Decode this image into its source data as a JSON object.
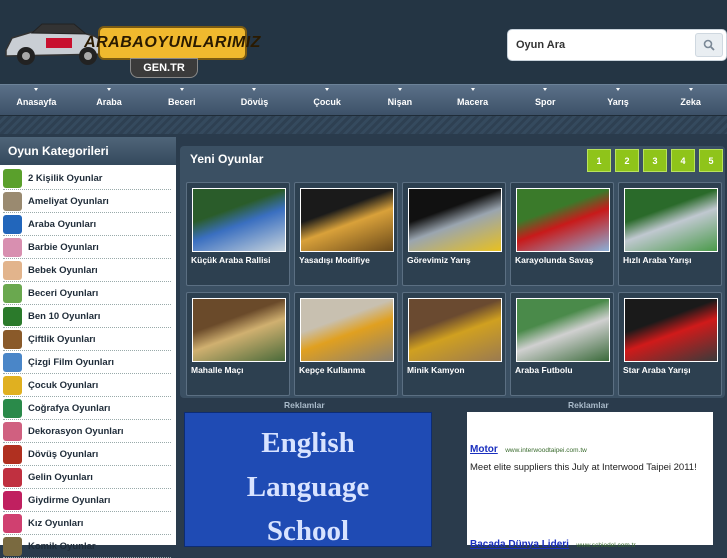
{
  "header": {
    "logo_text": "ARABAOYUNLARIMIZ",
    "logo_sub": "GEN.TR",
    "search_placeholder": "Oyun Ara"
  },
  "nav": {
    "items": [
      "Anasayfa",
      "Araba",
      "Beceri",
      "Dövüş",
      "Çocuk",
      "Nişan",
      "Macera",
      "Spor",
      "Yarış",
      "Zeka"
    ]
  },
  "sidebar": {
    "title": "Oyun Kategorileri",
    "items": [
      {
        "label": "2 Kişilik Oyunlar",
        "icon": "puzzle-icon",
        "color": "#5aa02c"
      },
      {
        "label": "Ameliyat Oyunları",
        "icon": "doctor-icon",
        "color": "#9a8a70"
      },
      {
        "label": "Araba Oyunları",
        "icon": "car-icon",
        "color": "#2266bb"
      },
      {
        "label": "Barbie Oyunları",
        "icon": "barbie-icon",
        "color": "#d88fb0"
      },
      {
        "label": "Bebek Oyunları",
        "icon": "baby-icon",
        "color": "#e2b48c"
      },
      {
        "label": "Beceri Oyunları",
        "icon": "skill-icon",
        "color": "#6aa84f"
      },
      {
        "label": "Ben 10 Oyunları",
        "icon": "ben10-icon",
        "color": "#2b7a2b"
      },
      {
        "label": "Çiftlik Oyunları",
        "icon": "farm-icon",
        "color": "#8a5a2a"
      },
      {
        "label": "Çizgi Film Oyunları",
        "icon": "cartoon-icon",
        "color": "#4a86c8"
      },
      {
        "label": "Çocuk Oyunları",
        "icon": "kids-icon",
        "color": "#e0b020"
      },
      {
        "label": "Coğrafya Oyunları",
        "icon": "globe-icon",
        "color": "#2a8a4a"
      },
      {
        "label": "Dekorasyon Oyunları",
        "icon": "decor-icon",
        "color": "#d06080"
      },
      {
        "label": "Dövüş Oyunları",
        "icon": "fight-icon",
        "color": "#b03020"
      },
      {
        "label": "Gelin Oyunları",
        "icon": "bride-icon",
        "color": "#c03040"
      },
      {
        "label": "Giydirme Oyunları",
        "icon": "dressup-icon",
        "color": "#c02060"
      },
      {
        "label": "Kız Oyunları",
        "icon": "girl-icon",
        "color": "#d04070"
      },
      {
        "label": "Komik Oyunlar",
        "icon": "funny-icon",
        "color": "#7a6a40"
      }
    ]
  },
  "main": {
    "title": "Yeni Oyunlar",
    "pages": [
      "1",
      "2",
      "3",
      "4",
      "5"
    ],
    "games": [
      {
        "title": "Küçük Araba Rallisi",
        "thumb_colors": [
          "#2a5c2a",
          "#3a6fc0",
          "#c8d4dc"
        ]
      },
      {
        "title": "Yasadışı Modifiye",
        "thumb_colors": [
          "#1a1a1a",
          "#d9a13a",
          "#6b4a1a"
        ]
      },
      {
        "title": "Görevimiz Yarış",
        "thumb_colors": [
          "#111111",
          "#9aa5b0",
          "#e8c020"
        ]
      },
      {
        "title": "Karayolunda Savaş",
        "thumb_colors": [
          "#3a7a2a",
          "#c81a1a",
          "#8bb0d8"
        ]
      },
      {
        "title": "Hızlı Araba Yarışı",
        "thumb_colors": [
          "#2a6a2a",
          "#c0c8d0",
          "#4a9a4a"
        ]
      },
      {
        "title": "Mahalle Maçı",
        "thumb_colors": [
          "#6a4a2a",
          "#d0b070",
          "#4a6a3a"
        ]
      },
      {
        "title": "Kepçe Kullanma",
        "thumb_colors": [
          "#c8c0b0",
          "#e0a020",
          "#8a8070"
        ]
      },
      {
        "title": "Minik Kamyon",
        "thumb_colors": [
          "#6a4a30",
          "#d0a020",
          "#9a7a50"
        ]
      },
      {
        "title": "Araba Futbolu",
        "thumb_colors": [
          "#4a8a4a",
          "#d0d0d0",
          "#3a6a3a"
        ]
      },
      {
        "title": "Star Araba Yarışı",
        "thumb_colors": [
          "#1a1a1a",
          "#d01a1a",
          "#3a3a3a"
        ]
      }
    ]
  },
  "ads": {
    "label": "Reklamlar",
    "left_text": [
      "English",
      "Language",
      "School"
    ],
    "right": {
      "headline1": "Motor",
      "url1": "www.interwoodtaipei.com.tw",
      "body1": "Meet elite suppliers this July at Interwood Taipei 2011!",
      "headline2": "Bacada Dünya Lideri",
      "url2": "www.schiedel.com.tr"
    }
  }
}
